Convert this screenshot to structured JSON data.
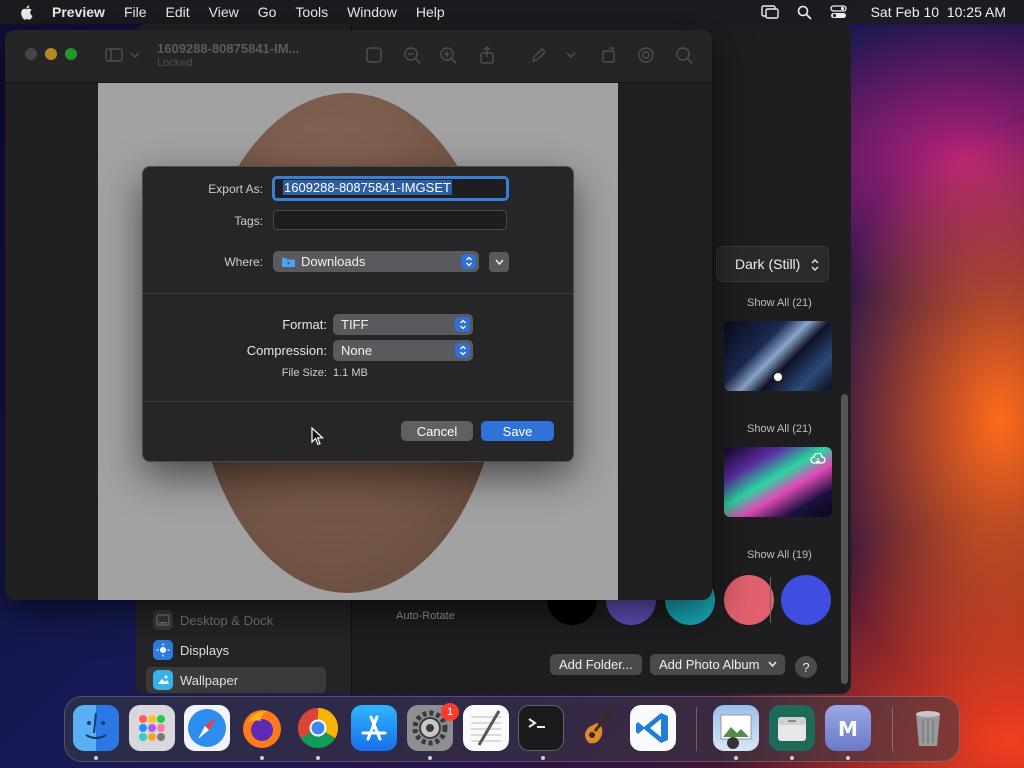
{
  "menubar": {
    "app_name": "Preview",
    "items": [
      "File",
      "Edit",
      "View",
      "Go",
      "Tools",
      "Window",
      "Help"
    ],
    "datetime": "Sat Feb 10  10:25 AM",
    "status_icons": [
      "screen-mirroring-icon",
      "spotlight-search-icon",
      "control-center-icon"
    ]
  },
  "preview_window": {
    "title": "1609288-80875841-IM...",
    "subtitle": "Locked"
  },
  "export_sheet": {
    "export_as_label": "Export As:",
    "export_as_value": "1609288-80875841-IMGSET",
    "tags_label": "Tags:",
    "tags_value": "",
    "where_label": "Where:",
    "where_value": "Downloads",
    "format_label": "Format:",
    "format_value": "TIFF",
    "compression_label": "Compression:",
    "compression_value": "None",
    "file_size_label": "File Size:",
    "file_size_value": "1.1 MB",
    "cancel_label": "Cancel",
    "save_label": "Save"
  },
  "settings": {
    "sidebar": [
      {
        "label": "Desktop & Dock",
        "dimmed": true
      },
      {
        "label": "Displays",
        "dimmed": false
      },
      {
        "label": "Wallpaper",
        "dimmed": false,
        "active": true
      }
    ],
    "style_select": "Dark (Still)",
    "show_all": [
      "Show All (21)",
      "Show All (21)",
      "Show All (19)"
    ],
    "auto_rotate": "Auto-Rotate",
    "add_folder": "Add Folder...",
    "add_photo_album": "Add Photo Album",
    "help": "?"
  },
  "dock": {
    "apps": [
      "Finder",
      "Launchpad",
      "Safari",
      "Firefox",
      "Chrome",
      "App Store",
      "System Settings",
      "TextEdit",
      "Terminal",
      "GarageBand",
      "Visual Studio Code",
      "Preview",
      "Archive Utility",
      "Mail Merge",
      "Trash"
    ],
    "system_settings_badge": "1"
  },
  "colors": {
    "accent": "#2f72d8",
    "sheet_bg": "#262628",
    "menubar_bg": "#1c1c1e"
  }
}
